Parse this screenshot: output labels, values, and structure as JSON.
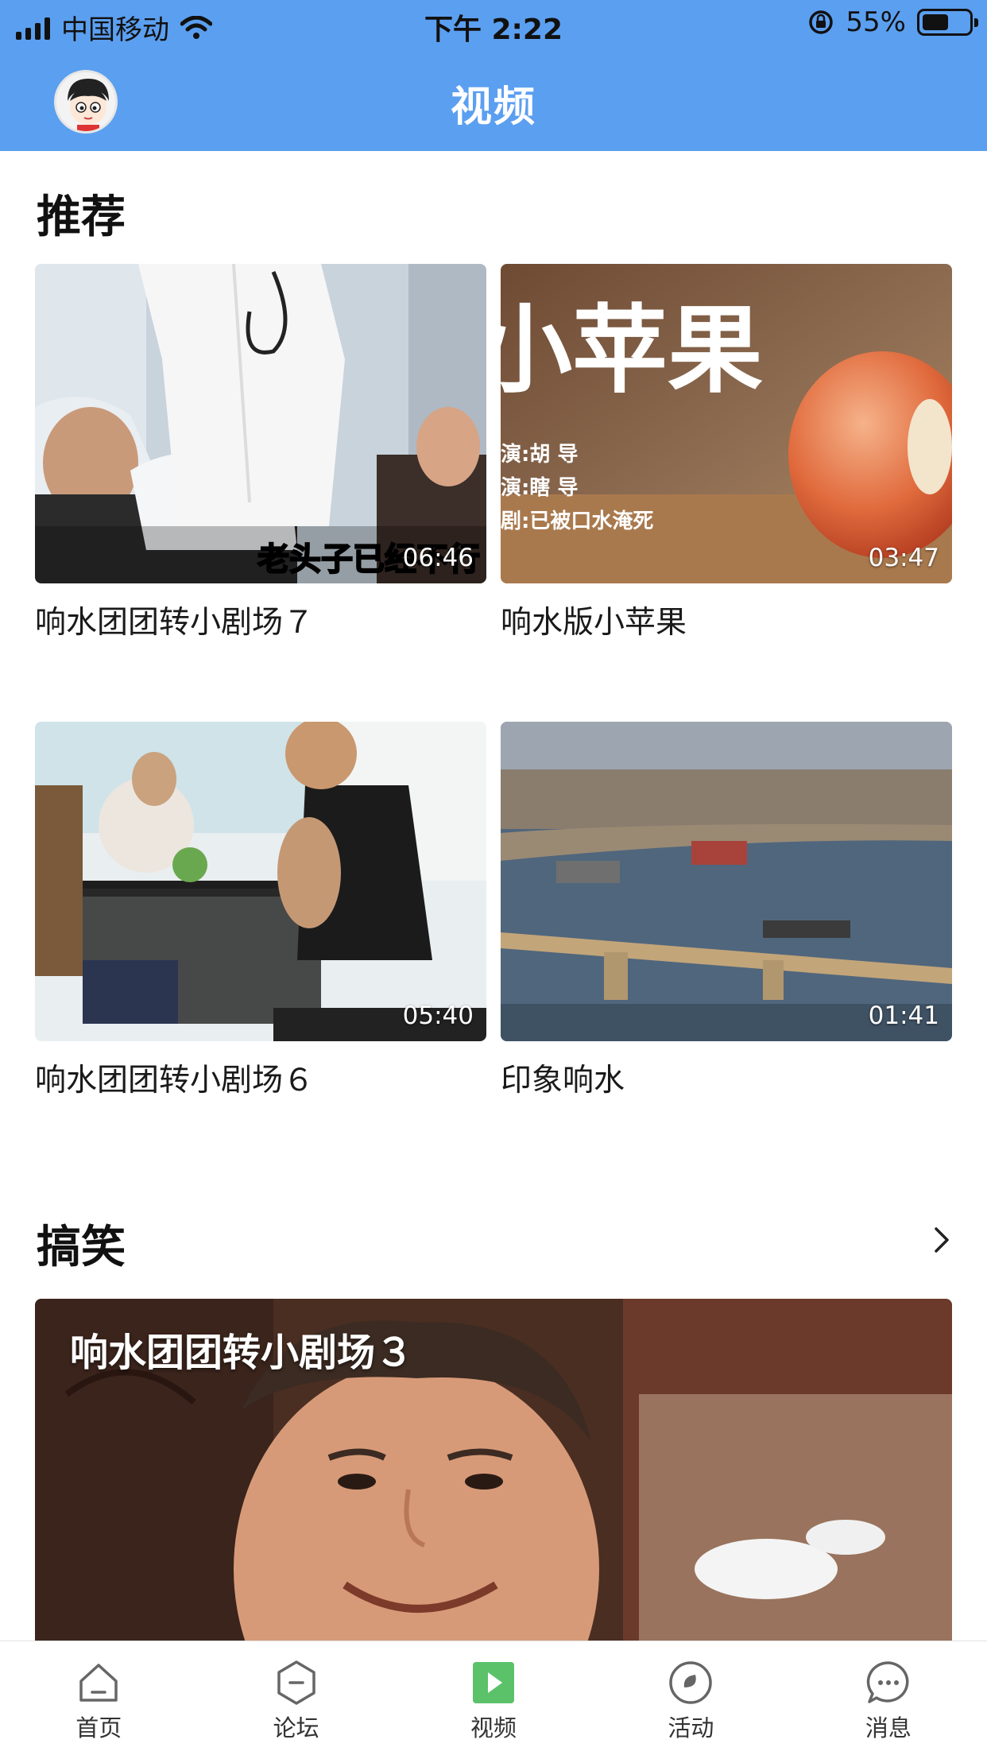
{
  "status_bar": {
    "carrier": "中国移动",
    "time": "下午 2:22",
    "battery": "55%"
  },
  "nav": {
    "title": "视频",
    "avatar_icon": "user-avatar",
    "color": "#5b9ff0"
  },
  "sections": {
    "recommended": {
      "title": "推荐",
      "videos": [
        {
          "title": "响水团团转小剧场７",
          "duration": "06:46",
          "caption": "老头子已经不行"
        },
        {
          "title": "响水版小苹果",
          "duration": "03:47",
          "poster_title": "小苹果",
          "poster_lines": [
            "演:胡 导",
            "演:瞎 导",
            "剧:已被口水淹死"
          ]
        },
        {
          "title": "响水团团转小剧场６",
          "duration": "05:40"
        },
        {
          "title": "印象响水",
          "duration": "01:41"
        }
      ]
    },
    "funny": {
      "title": "搞笑",
      "more_icon": "chevron-right-icon",
      "featured": {
        "title": "响水团团转小剧场３"
      }
    }
  },
  "tabs": [
    {
      "label": "首页",
      "icon": "home-icon",
      "active": false
    },
    {
      "label": "论坛",
      "icon": "forum-icon",
      "active": false
    },
    {
      "label": "视频",
      "icon": "video-play-icon",
      "active": true
    },
    {
      "label": "活动",
      "icon": "activity-icon",
      "active": false
    },
    {
      "label": "消息",
      "icon": "message-icon",
      "active": false
    }
  ],
  "colors": {
    "accent": "#5b9ff0",
    "active_tab": "#5cc26a"
  }
}
